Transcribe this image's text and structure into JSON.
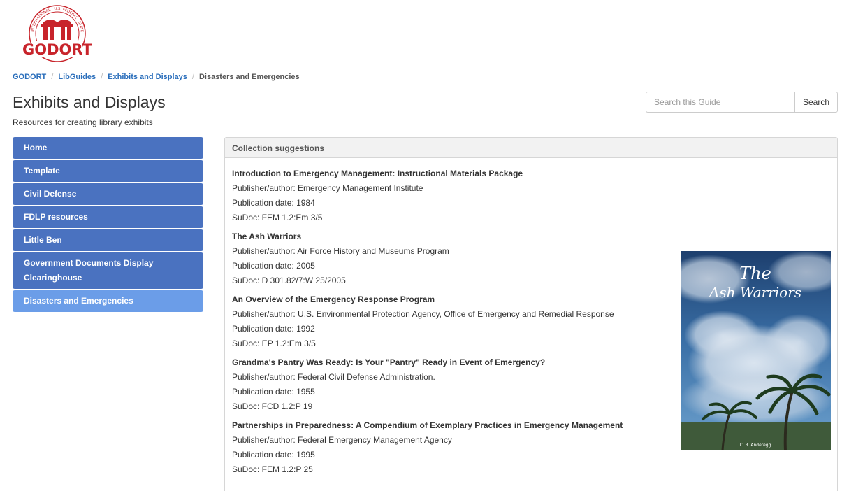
{
  "logo": {
    "text": "GODORT",
    "ring_text": "INTERNATIONAL · U.S. FEDERAL · STATE · LOCAL",
    "color": "#c8242b"
  },
  "breadcrumb": [
    {
      "label": "GODORT",
      "link": true
    },
    {
      "label": "LibGuides",
      "link": true
    },
    {
      "label": "Exhibits and Displays",
      "link": true
    },
    {
      "label": "Disasters and Emergencies",
      "link": false
    }
  ],
  "header": {
    "title": "Exhibits and Displays",
    "description": "Resources for creating library exhibits"
  },
  "search": {
    "placeholder": "Search this Guide",
    "button_label": "Search"
  },
  "nav": {
    "items": [
      {
        "label": "Home"
      },
      {
        "label": "Template"
      },
      {
        "label": "Civil Defense"
      },
      {
        "label": "FDLP resources"
      },
      {
        "label": "Little Ben"
      },
      {
        "label": "Government Documents Display Clearinghouse"
      },
      {
        "label": "Disasters and Emergencies",
        "active": true
      }
    ],
    "color": "#4a72c0",
    "active_color": "#6b9de8"
  },
  "panel": {
    "heading": "Collection suggestions",
    "entries": [
      {
        "title": "Introduction to Emergency Management: Instructional Materials Package",
        "publisher": "Publisher/author: Emergency Management Institute",
        "date": "Publication date: 1984",
        "sudoc": "SuDoc: FEM 1.2:Em 3/5"
      },
      {
        "title": "The Ash Warriors",
        "publisher": "Publisher/author: Air Force History and Museums Program",
        "date": "Publication date: 2005",
        "sudoc": "SuDoc: D 301.82/7:W 25/2005"
      },
      {
        "title": "An Overview of the Emergency Response Program",
        "publisher": "Publisher/author: U.S. Environmental Protection Agency, Office of Emergency and Remedial Response",
        "date": "Publication date: 1992",
        "sudoc": "SuDoc: EP 1.2:Em 3/5"
      },
      {
        "title": "Grandma's Pantry Was Ready: Is Your \"Pantry\" Ready in Event of Emergency?",
        "publisher": "Publisher/author: Federal Civil Defense Administration.",
        "date": "Publication date: 1955",
        "sudoc": "SuDoc: FCD 1.2:P 19"
      },
      {
        "title": "Partnerships in Preparedness: A Compendium of Exemplary Practices in Emergency Management",
        "publisher": "Publisher/author: Federal Emergency Management Agency",
        "date": "Publication date: 1995",
        "sudoc": "SuDoc: FEM 1.2:P 25"
      }
    ]
  },
  "book_cover": {
    "title_line1": "The",
    "title_line2": "Ash Warriors",
    "author": "C. R. Anderegg"
  }
}
